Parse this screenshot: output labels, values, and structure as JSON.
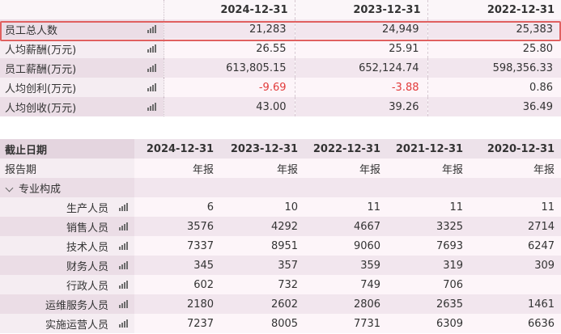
{
  "summary": {
    "years": [
      "2024-12-31",
      "2023-12-31",
      "2022-12-31"
    ],
    "rows": [
      {
        "label": "员工总人数",
        "values": [
          "21,283",
          "24,949",
          "25,383"
        ]
      },
      {
        "label": "人均薪酬(万元)",
        "values": [
          "26.55",
          "25.91",
          "25.80"
        ]
      },
      {
        "label": "员工薪酬(万元)",
        "values": [
          "613,805.15",
          "652,124.74",
          "598,356.33"
        ]
      },
      {
        "label": "人均创利(万元)",
        "values": [
          "-9.69",
          "-3.88",
          "0.86"
        ]
      },
      {
        "label": "人均创收(万元)",
        "values": [
          "43.00",
          "39.26",
          "36.49"
        ]
      }
    ],
    "negative_color": "#e23b3b",
    "highlight_color": "#e06060"
  },
  "detail": {
    "header_label": "截止日期",
    "years": [
      "2024-12-31",
      "2023-12-31",
      "2022-12-31",
      "2021-12-31",
      "2020-12-31"
    ],
    "report_label": "报告期",
    "report_values": [
      "年报",
      "年报",
      "年报",
      "年报",
      "年报"
    ],
    "group_label": "专业构成",
    "rows": [
      {
        "label": "生产人员",
        "values": [
          "6",
          "10",
          "11",
          "11",
          "11"
        ]
      },
      {
        "label": "销售人员",
        "values": [
          "3576",
          "4292",
          "4667",
          "3325",
          "2714"
        ]
      },
      {
        "label": "技术人员",
        "values": [
          "7337",
          "8951",
          "9060",
          "7693",
          "6247"
        ]
      },
      {
        "label": "财务人员",
        "values": [
          "345",
          "357",
          "359",
          "319",
          "309"
        ]
      },
      {
        "label": "行政人员",
        "values": [
          "602",
          "732",
          "749",
          "706",
          ""
        ]
      },
      {
        "label": "运维服务人员",
        "values": [
          "2180",
          "2602",
          "2806",
          "2635",
          "1461"
        ]
      },
      {
        "label": "实施运营人员",
        "values": [
          "7237",
          "8005",
          "7731",
          "6309",
          "6636"
        ]
      }
    ]
  },
  "icons": {
    "chart": "bar-chart-icon",
    "chevron": "chevron-down-icon"
  }
}
